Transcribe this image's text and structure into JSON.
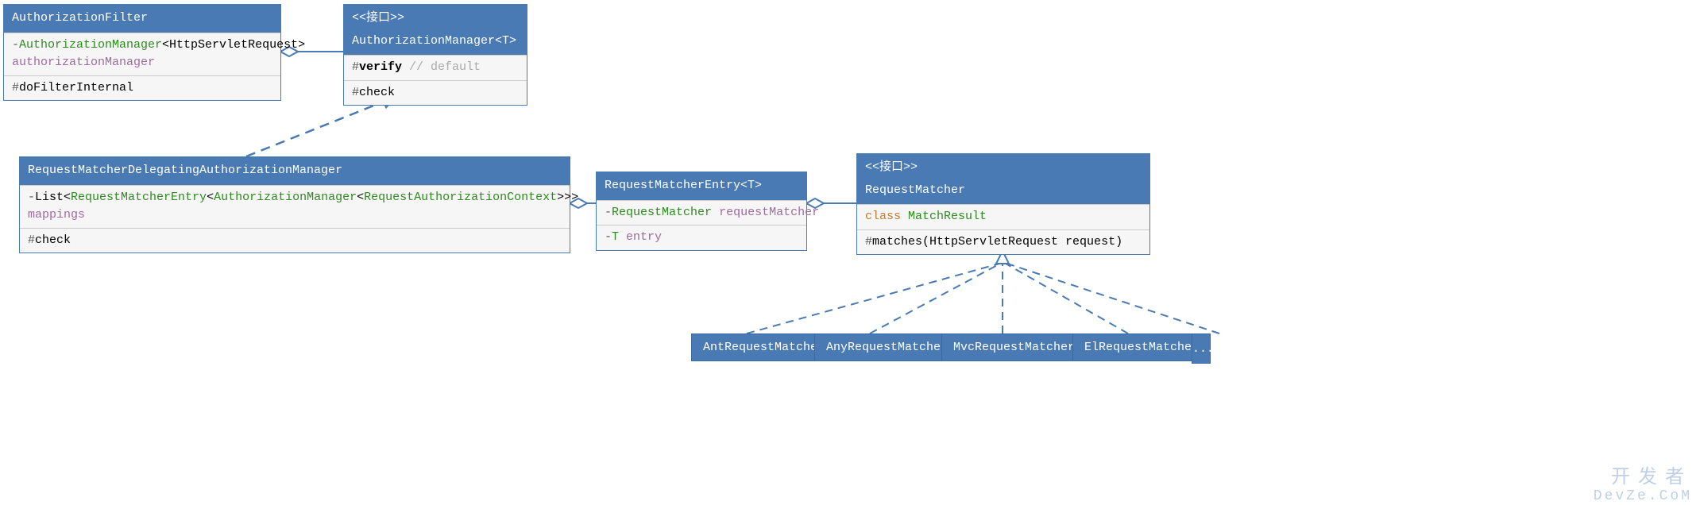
{
  "classes": {
    "authFilter": {
      "title": "AuthorizationFilter",
      "field_vis": "-",
      "field_type1": "AuthorizationManager",
      "field_type2": "<HttpServletRequest>",
      "field_name": "authorizationManager",
      "method_vis": "#",
      "method_name": "doFilterInternal"
    },
    "authManager": {
      "stereotype": "<<接口>>",
      "title": "AuthorizationManager<T>",
      "m1_vis": "#",
      "m1_name": "verify",
      "m1_comment": " // default",
      "m2_vis": "#",
      "m2_name": "check"
    },
    "delegating": {
      "title": "RequestMatcherDelegatingAuthorizationManager",
      "field_vis": "-",
      "field_pre": "List<",
      "field_t1": "RequestMatcherEntry",
      "field_mid1": "<",
      "field_t2": "AuthorizationManager",
      "field_mid2": "<",
      "field_t3": "RequestAuthorizationContext",
      "field_post": ">>>",
      "field_name": "mappings",
      "method_vis": "#",
      "method_name": "check"
    },
    "entry": {
      "title": "RequestMatcherEntry<T>",
      "f1_vis": "-",
      "f1_type": "RequestMatcher",
      "f1_name": "requestMatcher",
      "f2_vis": "-",
      "f2_type": "T",
      "f2_name": "entry"
    },
    "matcher": {
      "stereotype": "<<接口>>",
      "title": "RequestMatcher",
      "inner_kw": "class",
      "inner_name": "MatchResult",
      "m_vis": "#",
      "m_sig": "matches(HttpServletRequest request)"
    }
  },
  "impls": {
    "ant": "AntRequestMatcher",
    "any": "AnyRequestMatcher",
    "mvc": "MvcRequestMatcher",
    "el": "ElRequestMatcher",
    "more": "..."
  },
  "watermark": {
    "cn": "开发者",
    "en": "DevZe.CoM"
  }
}
